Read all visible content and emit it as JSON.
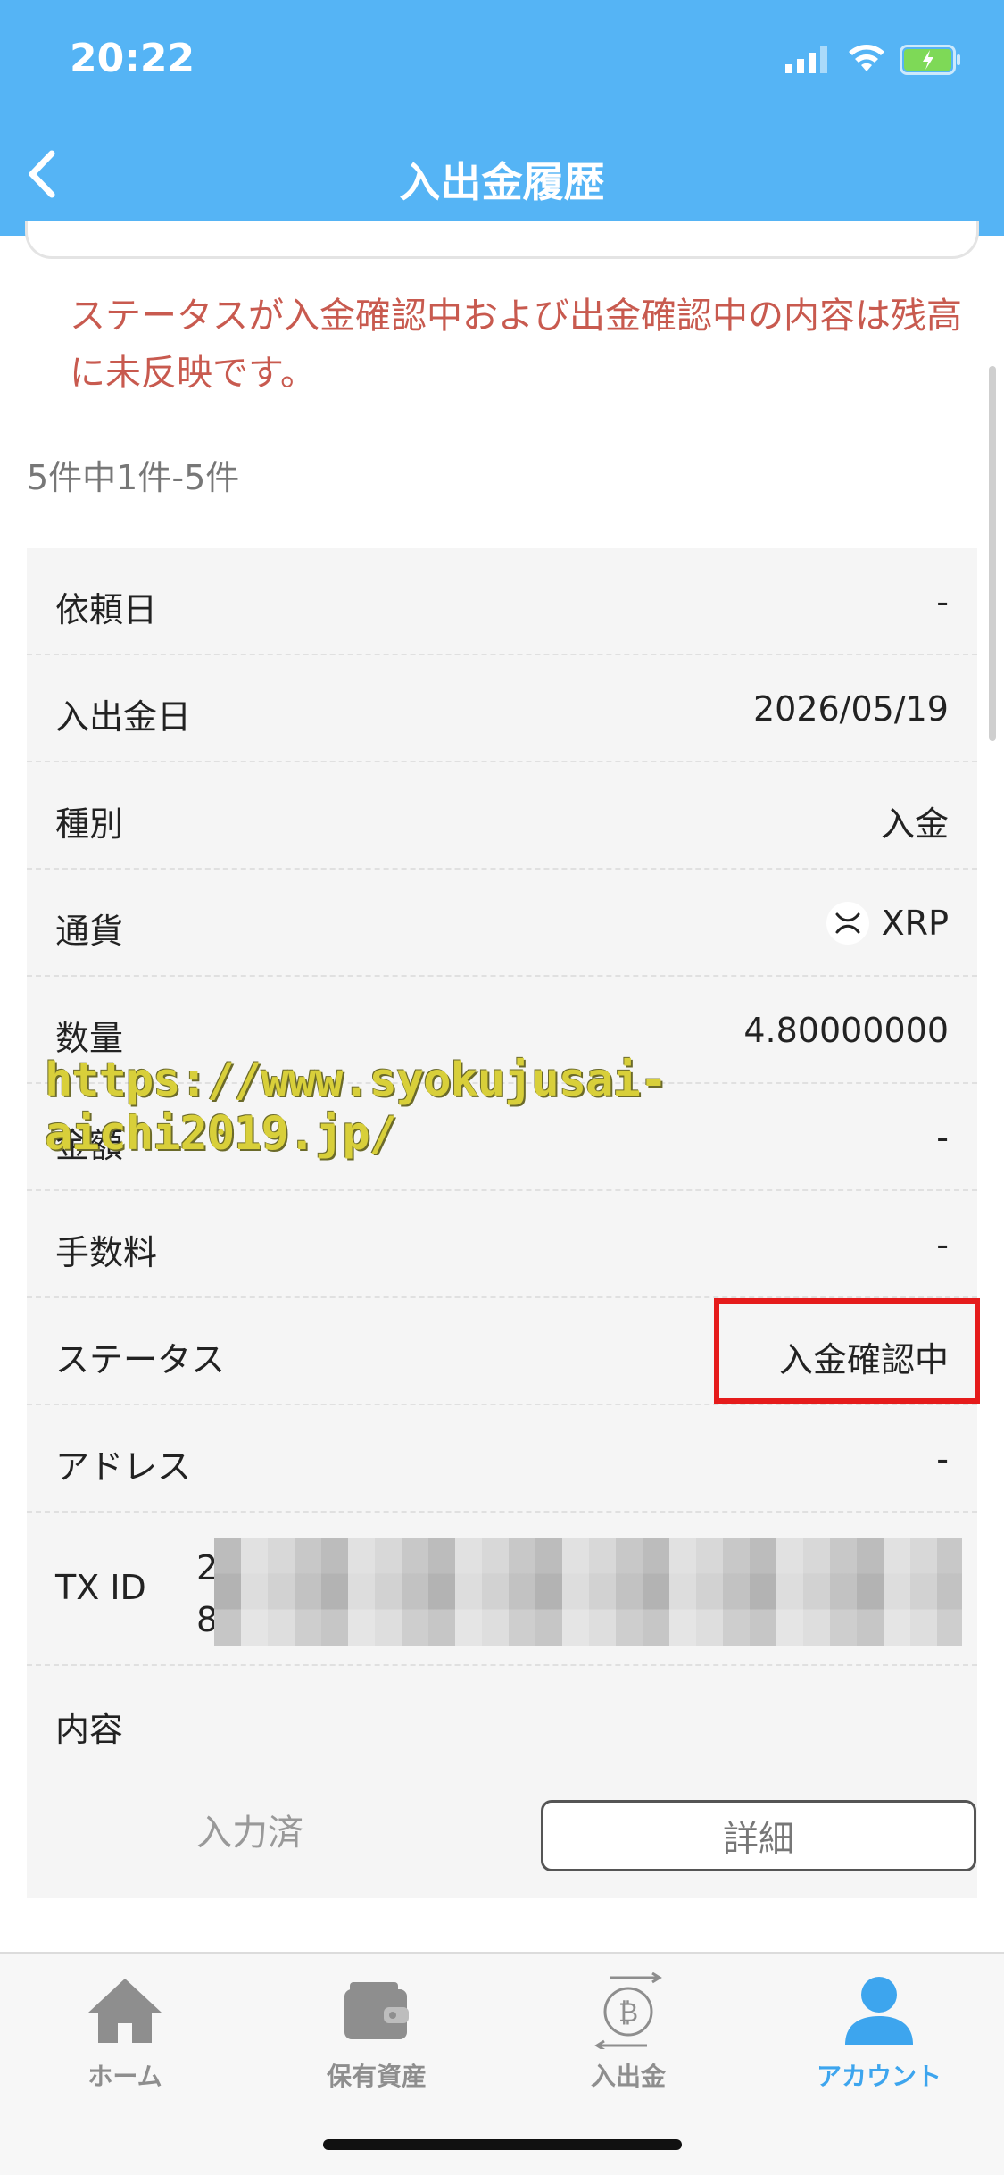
{
  "status_bar": {
    "time": "20:22"
  },
  "header": {
    "title": "入出金履歴"
  },
  "notice": "ステータスが入金確認中および出金確認中の内容は残高に未反映です。",
  "count_text": "5件中1件-5件",
  "record": {
    "rows": [
      {
        "label": "依頼日",
        "value": "-"
      },
      {
        "label": "入出金日",
        "value": "2026/05/19"
      },
      {
        "label": "種別",
        "value": "入金"
      },
      {
        "label": "通貨",
        "value": "XRP"
      },
      {
        "label": "数量",
        "value": "4.80000000"
      },
      {
        "label": "金額",
        "value": "-"
      },
      {
        "label": "手数料",
        "value": "-"
      },
      {
        "label": "ステータス",
        "value": "入金確認中"
      },
      {
        "label": "アドレス",
        "value": "-"
      }
    ],
    "tx": {
      "label": "TX ID",
      "line1_prefix": "2",
      "line2_prefix": "8"
    },
    "content_label": "内容",
    "entered_label": "入力済",
    "detail_button": "詳細"
  },
  "watermark": "https://www.syokujusai-aichi2019.jp/",
  "tabs": [
    {
      "label": "ホーム",
      "icon": "home-icon"
    },
    {
      "label": "保有資産",
      "icon": "wallet-icon"
    },
    {
      "label": "入出金",
      "icon": "bitcoin-transfer-icon"
    },
    {
      "label": "アカウント",
      "icon": "account-icon",
      "active": true
    }
  ],
  "colors": {
    "header": "#55b4f5",
    "notice": "#c85a4f",
    "highlight": "#e51b1b",
    "active_tab": "#3da5ee"
  }
}
